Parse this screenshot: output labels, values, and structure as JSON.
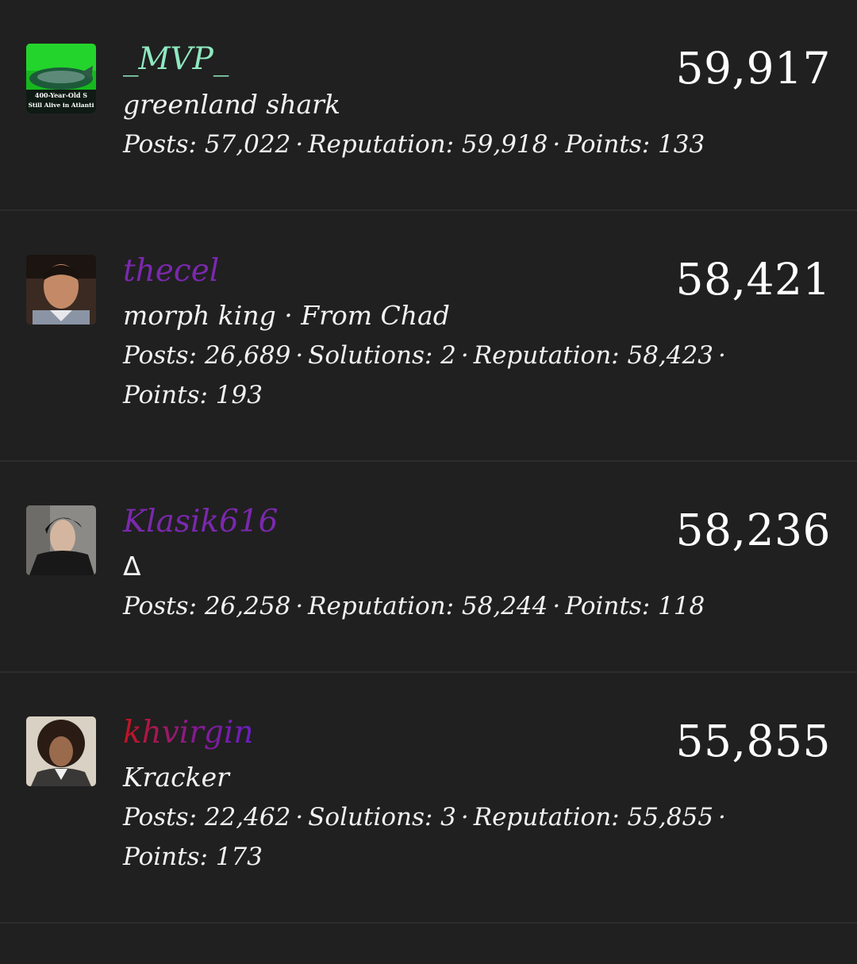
{
  "users": [
    {
      "name": "_MVP_",
      "subtitle": "greenland shark",
      "stats_line1": [
        "Posts: 57,022",
        "Reputation: 59,918",
        "Points: 133"
      ],
      "stats_line2": [],
      "score": "59,917",
      "avatar_text": [
        "400-Year-Old S",
        "Still Alive in Atlanti"
      ],
      "name_color": "#8fe9c0"
    },
    {
      "name": "thecel",
      "subtitle": "morph king · From Chad",
      "stats_line1": [
        "Posts: 26,689",
        "Solutions: 2",
        "Reputation: 58,423"
      ],
      "stats_line2": [
        "Points: 193"
      ],
      "score": "58,421",
      "name_color": "#7b28ae"
    },
    {
      "name": "Klasik616",
      "subtitle": "Δ",
      "stats_line1": [
        "Posts: 26,258",
        "Reputation: 58,244",
        "Points: 118"
      ],
      "stats_line2": [],
      "score": "58,236",
      "name_color": "#7b28ae"
    },
    {
      "name": "khvirgin",
      "subtitle": "Kracker",
      "stats_line1": [
        "Posts: 22,462",
        "Solutions: 3",
        "Reputation: 55,855"
      ],
      "stats_line2": [
        "Points: 173"
      ],
      "score": "55,855",
      "name_color": "#c4141e"
    }
  ],
  "separator": "·",
  "colors": {
    "background": "#202020",
    "divider": "#2c2c2c",
    "text": "#f2f2f2"
  }
}
